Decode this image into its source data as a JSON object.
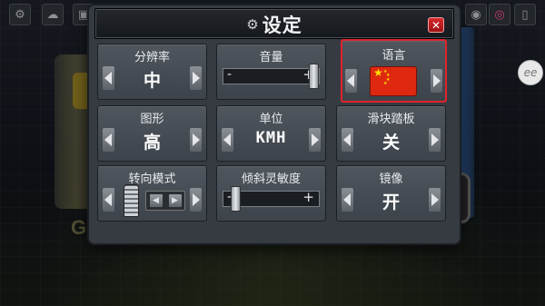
{
  "dialog": {
    "title": "设定",
    "close_label": "✕"
  },
  "cells": {
    "resolution": {
      "label": "分辨率",
      "value": "中"
    },
    "volume": {
      "label": "音量",
      "minus": "-",
      "plus": "+",
      "level": 1.0
    },
    "language": {
      "label": "语言",
      "value_icon": "china-flag-icon"
    },
    "graphics": {
      "label": "图形",
      "value": "高"
    },
    "units": {
      "label": "单位",
      "value": "KMH"
    },
    "slider_pedal": {
      "label": "滑块踏板",
      "value": "关"
    },
    "steering_mode": {
      "label": "转向模式"
    },
    "tilt_sensitivity": {
      "label": "倾斜灵敏度",
      "minus": "-",
      "plus": "+",
      "level": 0.08
    },
    "mirror": {
      "label": "镜像",
      "value": "开"
    }
  },
  "colors": {
    "accent_selected": "#e0232c",
    "dialog_bg": "#363b42",
    "close_red": "#c4191e"
  },
  "hud_icons": [
    "gear-icon",
    "cloud-icon",
    "car-icon",
    "camera-icon",
    "instagram-icon",
    "door-icon"
  ],
  "background_text": "GA"
}
